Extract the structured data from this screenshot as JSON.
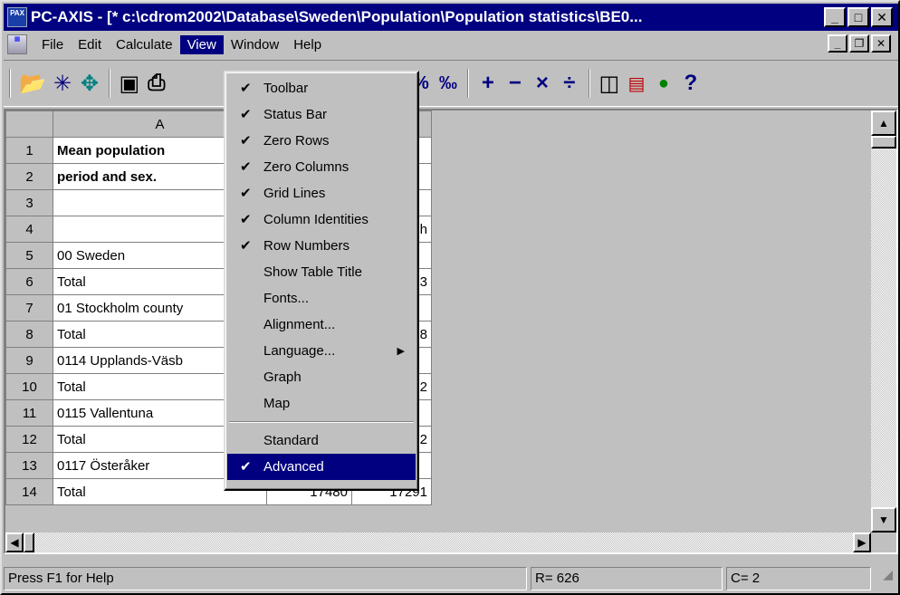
{
  "window": {
    "title": "PC-AXIS - [* c:\\cdrom2002\\Database\\Sweden\\Population\\Population statistics\\BE0...",
    "app_icon_text": "PAX"
  },
  "menubar": {
    "items": [
      "File",
      "Edit",
      "Calculate",
      "View",
      "Window",
      "Help"
    ],
    "active": "View"
  },
  "toolbar": {
    "icons": [
      "open-folder",
      "asterisk",
      "move-arrows",
      "save-disk",
      "printer",
      "sum",
      "percent",
      "per-mille",
      "plus",
      "minus",
      "multiply",
      "divide",
      "columns",
      "chart",
      "globe",
      "help"
    ]
  },
  "sheet": {
    "column_a_header": "A",
    "rows": [
      {
        "num": "1",
        "a": "Mean population",
        "b": "",
        "c": ""
      },
      {
        "num": "2",
        "a": "period and sex.",
        "b": "",
        "c": ""
      },
      {
        "num": "3",
        "a": "",
        "b": "",
        "c": ""
      },
      {
        "num": "4",
        "a": "",
        "b": "",
        "c": "h"
      },
      {
        "num": "5",
        "a": "00 Sweden",
        "b": "",
        "c": ""
      },
      {
        "num": "6",
        "a": " Total",
        "b": "",
        "c": "363"
      },
      {
        "num": "7",
        "a": "01 Stockholm county",
        "b": "",
        "c": ""
      },
      {
        "num": "8",
        "a": " Total",
        "b": "",
        "c": "998"
      },
      {
        "num": "9",
        "a": "0114 Upplands-Väsb",
        "b": "",
        "c": ""
      },
      {
        "num": "10",
        "a": " Total",
        "b": "",
        "c": "912"
      },
      {
        "num": "11",
        "a": "0115 Vallentuna",
        "b": "",
        "c": ""
      },
      {
        "num": "12",
        "a": " Total",
        "b": "",
        "c": "752"
      },
      {
        "num": "13",
        "a": "0117 Österåker",
        "b": "",
        "c": ""
      },
      {
        "num": "14",
        "a": " Total",
        "b": "17480",
        "c": "17291"
      }
    ]
  },
  "view_menu": {
    "items": [
      {
        "label": "Toolbar",
        "checked": true
      },
      {
        "label": "Status Bar",
        "checked": true
      },
      {
        "label": "Zero Rows",
        "checked": true
      },
      {
        "label": "Zero Columns",
        "checked": true
      },
      {
        "label": "Grid Lines",
        "checked": true
      },
      {
        "label": "Column Identities",
        "checked": true
      },
      {
        "label": "Row Numbers",
        "checked": true
      },
      {
        "label": "Show Table Title",
        "checked": false
      },
      {
        "label": "Fonts...",
        "checked": false
      },
      {
        "label": "Alignment...",
        "checked": false
      },
      {
        "label": "Language...",
        "checked": false,
        "submenu": true
      },
      {
        "label": "Graph",
        "checked": false
      },
      {
        "label": "Map",
        "checked": false
      },
      {
        "label": "Standard",
        "checked": false
      },
      {
        "label": "Advanced",
        "checked": true,
        "selected": true
      }
    ]
  },
  "statusbar": {
    "help": "Press F1 for Help",
    "row": "R= 626",
    "col": "C= 2"
  }
}
